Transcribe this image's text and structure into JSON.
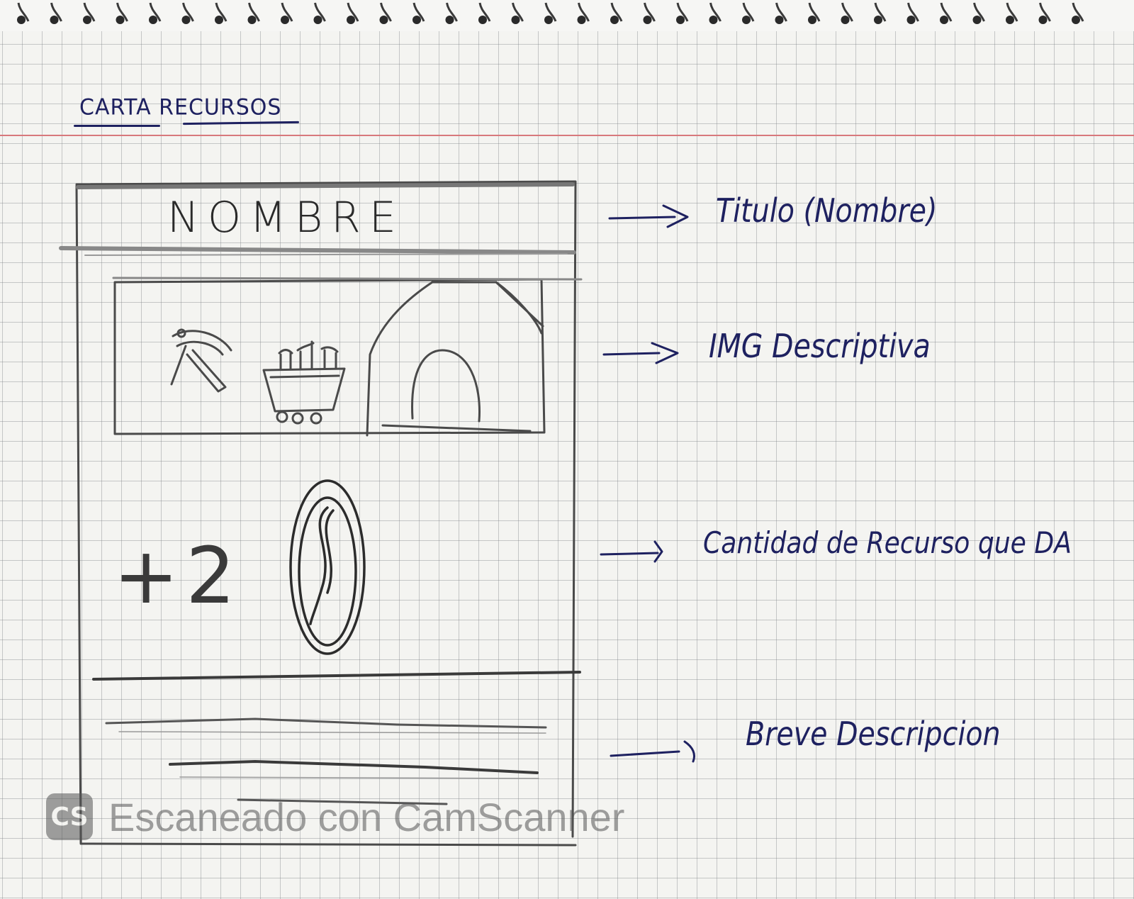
{
  "header": {
    "title": "CARTA RECURSOS"
  },
  "card": {
    "name": "NOMBRE",
    "amount": "+2"
  },
  "annotations": [
    {
      "label": "Titulo (Nombre)"
    },
    {
      "label": "IMG Descriptiva"
    },
    {
      "label": "Cantidad de Recurso que DA"
    },
    {
      "label": "Breve Descripcion"
    }
  ],
  "icons": {
    "pickaxe": "pickaxe-icon",
    "mine_cart": "mine-cart-icon",
    "mine_entrance": "mine-entrance-icon",
    "resource_token": "resource-token-icon"
  },
  "watermark": {
    "logo": "CS",
    "text": "Escaneado con CamScanner"
  },
  "colors": {
    "paper": "#f4f4f1",
    "grid": "#7d8286",
    "ink": "#1e2160",
    "pencil": "#3a3a3a",
    "margin_line": "#d8787c"
  }
}
